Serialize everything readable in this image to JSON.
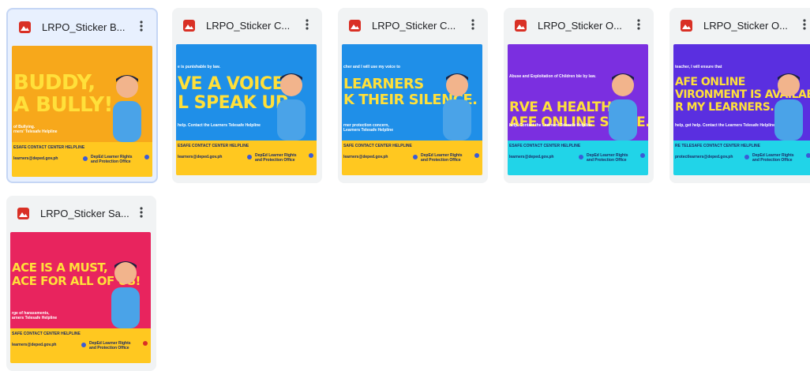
{
  "files": [
    {
      "name": "LRPO_Sticker B...",
      "selected": true,
      "hero_color": "#f7a81b",
      "small_top": "",
      "big_lines": [
        "BUDDY,",
        "A BULLY!"
      ],
      "small_bottom": [
        "of Bullying.",
        "rners' Telesafe Helpline"
      ],
      "contact": "ESAFE CONTACT CENTER HELPLINE",
      "email": "learners@deped.gov.ph",
      "office": "DepEd Learner Rights and Protection Office"
    },
    {
      "name": "LRPO_Sticker C...",
      "selected": false,
      "hero_color": "#1f8fe8",
      "small_top": "e is punishable by law.",
      "big_lines": [
        "VE A VOICE.",
        "L SPEAK UP."
      ],
      "small_bottom": [
        "help. Contact the Learners Telesafe Helpline"
      ],
      "contact": "ESAFE CONTACT CENTER HELPLINE",
      "email": "learners@deped.gov.ph",
      "office": "DepEd Learner Rights and Protection Office"
    },
    {
      "name": "LRPO_Sticker C...",
      "selected": false,
      "hero_color": "#1f8fe8",
      "small_top": "cher and I will use my voice to",
      "big_lines": [
        "LEARNERS",
        "K THEIR SILENCE."
      ],
      "small_bottom": [
        "rner protection concern,",
        "Learners Telesafe Helpline"
      ],
      "contact": "SAFE CONTACT CENTER HELPLINE",
      "email": "learners@deped.gov.ph",
      "office": "DepEd Learner Rights and Protection Office"
    },
    {
      "name": "LRPO_Sticker O...",
      "selected": false,
      "hero_color": "#7b2fe0",
      "small_top": "Abuse and Exploitation of Children ble by law.",
      "big_lines": [
        "RVE A HEALTHY",
        "AFE ONLINE SPACE."
      ],
      "small_bottom": [
        "help. Contact the Learners Telesafe Helpline"
      ],
      "contact": "ESAFE CONTACT CENTER HELPLINE",
      "email": "learners@deped.gov.ph",
      "office": "DepEd Learner Rights and Protection Office"
    },
    {
      "name": "LRPO_Sticker O...",
      "selected": false,
      "hero_color": "#5a2fe0",
      "small_top": "teacher, I will ensure that",
      "big_lines": [
        "AFE ONLINE",
        "VIRONMENT IS AVAILABLE",
        "R MY LEARNERS."
      ],
      "small_bottom": [
        "help, get help. Contact the Learners Telesafe Helpline"
      ],
      "contact": "RE TELESAFE CONTACT CENTER HELPLINE",
      "email": "protectlearners@deped.gov.ph",
      "office": "DepEd Learner Rights and Protection Office"
    },
    {
      "name": "LRPO_Sticker Sa...",
      "selected": false,
      "hero_color": "#e8245e",
      "small_top": "",
      "big_lines": [
        "ACE IS A MUST,",
        "ACE FOR ALL OF US!"
      ],
      "small_bottom": [
        "rge of harassments,",
        "arners Telesafe Helpline"
      ],
      "contact": "SAFE CONTACT CENTER HELPLINE",
      "email": "learners@deped.gov.ph",
      "office": "DepEd Learner Rights and Protection Office"
    }
  ],
  "colors": {
    "file_icon": "#d93025",
    "footer_yellow": "#ffc820",
    "footer_cyan": "#21d4e8",
    "headline_yellow": "#ffe03a"
  },
  "icons": {
    "file_type": "image-file-icon",
    "menu": "more-vert-icon"
  }
}
